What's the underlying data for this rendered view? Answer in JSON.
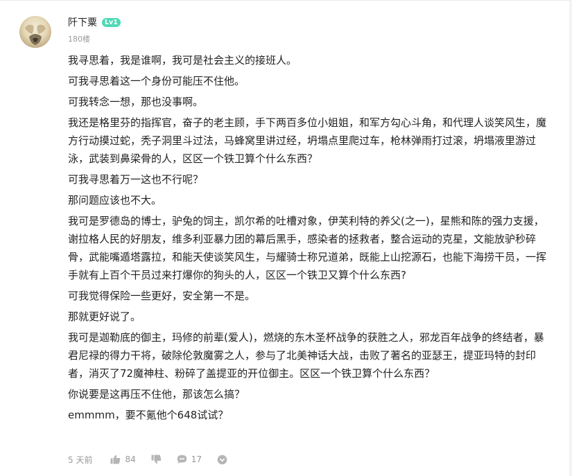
{
  "comment": {
    "username": "阡下粟",
    "level_badge": "Lv1",
    "floor": "180楼",
    "paragraphs": [
      "我寻思着，我是谁啊，我可是社会主义的接班人。",
      "可我寻思着这一个身份可能压不住他。",
      "可我转念一想，那也没事啊。",
      "我还是格里芬的指挥官，奋子的老主顾，手下两百多位小姐姐，和军方勾心斗角，和代理人谈笑风生，魔方行动摸过蛇，秃子洞里斗过法，马蜂窝里讲过经，坍塌点里爬过车，枪林弹雨打过滚，坍塌液里游过泳，武装到鼻梁骨的人，区区一个铁卫算个什么东西？",
      "可我寻思着万一这也不行呢？",
      "那问题应该也不大。",
      "我可是罗德岛的博士，驴兔的饲主，凯尔希的吐槽对象，伊芙利特的养父(之一)，星熊和陈的强力支援，谢拉格人民的好朋友，维多利亚暴力团的幕后黑手，感染者的拯救者，整合运动的克星，文能放驴秒碎骨，武能嘴遁塔露拉，和能天使谈笑风生，与耀骑士称兄道弟，既能上山挖源石，也能下海捞干员，一挥手就有上百个干员过来打爆你的狗头的人，区区一个铁卫又算个什么东西?",
      "可我觉得保险一些更好，安全第一不是。",
      "那就更好说了。",
      "我可是迦勒底的御主，玛修的前辈(爱人)，燃烧的东木圣杯战争的获胜之人，邪龙百年战争的终结者，暴君尼禄的得力干将，破除伦敦魔雾之人，参与了北美神话大战，击败了著名的亚瑟王，提亚玛特的封印者，消灭了72魔神柱、粉碎了盖提亚的开位御主。区区一个铁卫算个什么东西？",
      "你说要是这再压不住他，那该怎么搞？",
      "emmmm，要不氪他个648试试？"
    ],
    "footer": {
      "time": "5 天前",
      "like_count": "84",
      "reply_count": "17"
    }
  },
  "icons": {
    "like": "thumbs-up-icon",
    "dislike": "thumbs-down-icon",
    "reply": "chat-bubble-icon",
    "more": "chevron-down-circle-icon"
  },
  "colors": {
    "level_badge": "#4fd8b6",
    "meta_text": "#999999",
    "body_text": "#222222"
  }
}
